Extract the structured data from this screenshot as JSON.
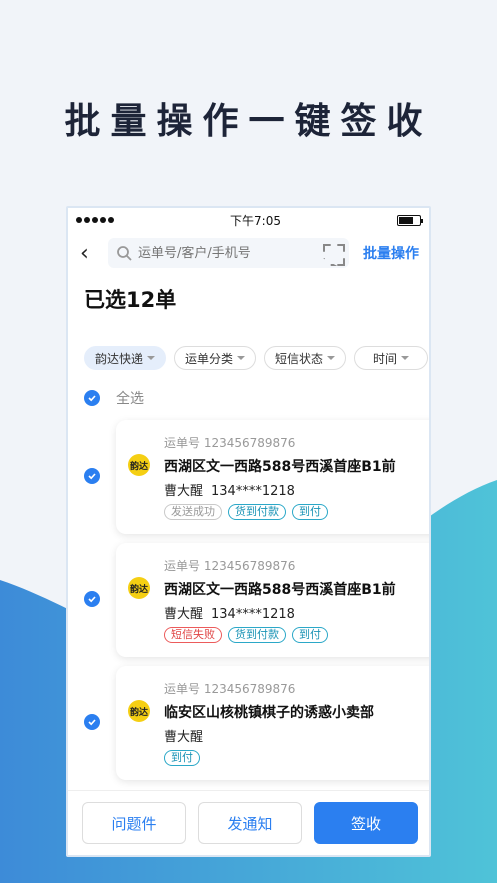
{
  "headline": "批量操作一键签收",
  "status_bar": {
    "time": "下午7:05"
  },
  "nav": {
    "search_placeholder": "运单号/客户/手机号",
    "batch_label": "批量操作"
  },
  "selected_title": "已选12单",
  "filters": [
    {
      "label": "韵达快递",
      "active": true
    },
    {
      "label": "运单分类",
      "active": false
    },
    {
      "label": "短信状态",
      "active": false
    },
    {
      "label": "时间",
      "active": false
    }
  ],
  "select_all_label": "全选",
  "logo_text": "韵达",
  "shipments": [
    {
      "waybill": "运单号 123456789876",
      "address": "西湖区文一西路588号西溪首座B1前",
      "name": "曹大醒",
      "phone": "134****1218",
      "tags": [
        {
          "text": "发送成功",
          "style": "gray"
        },
        {
          "text": "货到付款",
          "style": "blue"
        },
        {
          "text": "到付",
          "style": "blue"
        }
      ]
    },
    {
      "waybill": "运单号 123456789876",
      "address": "西湖区文一西路588号西溪首座B1前",
      "name": "曹大醒",
      "phone": "134****1218",
      "tags": [
        {
          "text": "短信失败",
          "style": "red"
        },
        {
          "text": "货到付款",
          "style": "blue"
        },
        {
          "text": "到付",
          "style": "blue"
        }
      ]
    },
    {
      "waybill": "运单号 123456789876",
      "address": "临安区山核桃镇棋子的诱惑小卖部",
      "name": "曹大醒",
      "phone": "",
      "tags": [
        {
          "text": "到付",
          "style": "blue"
        }
      ]
    }
  ],
  "buttons": {
    "problem": "问题件",
    "notify": "发通知",
    "sign": "签收"
  },
  "colors": {
    "accent": "#2b7ff0",
    "headline": "#1d2438",
    "wave_start": "#3d8bd8",
    "wave_end": "#4fc3d8"
  }
}
